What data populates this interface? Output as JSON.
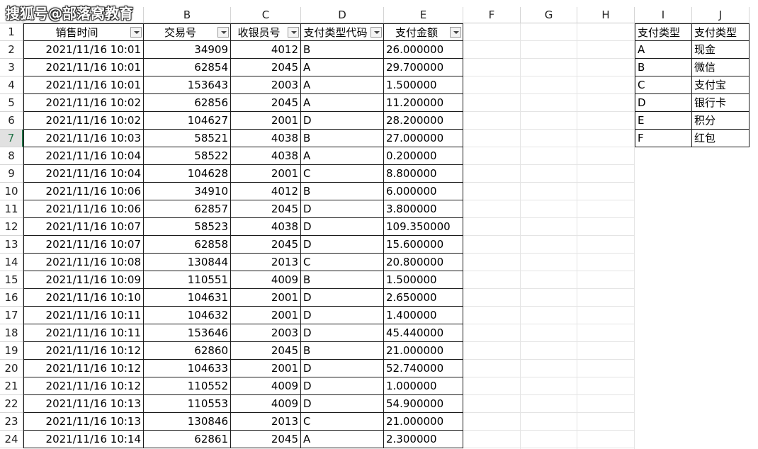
{
  "watermark": "搜狐号@部落窝教育",
  "columns": [
    "A",
    "B",
    "C",
    "D",
    "E",
    "F",
    "G",
    "H",
    "I",
    "J"
  ],
  "selected_row": 7,
  "headers": {
    "sale_time": "销售时间",
    "transaction_no": "交易号",
    "cashier_no": "收银员号",
    "pay_type_code": "支付类型代码",
    "pay_amount": "支付金额"
  },
  "rows": [
    {
      "time": "2021/11/16 10:01",
      "txn": "34909",
      "cashier": "4012",
      "type": "B",
      "amount": "26.000000"
    },
    {
      "time": "2021/11/16 10:01",
      "txn": "62854",
      "cashier": "2045",
      "type": "A",
      "amount": "29.700000"
    },
    {
      "time": "2021/11/16 10:01",
      "txn": "153643",
      "cashier": "2003",
      "type": "A",
      "amount": "1.500000"
    },
    {
      "time": "2021/11/16 10:02",
      "txn": "62856",
      "cashier": "2045",
      "type": "A",
      "amount": "11.200000"
    },
    {
      "time": "2021/11/16 10:02",
      "txn": "104627",
      "cashier": "2001",
      "type": "D",
      "amount": "28.200000"
    },
    {
      "time": "2021/11/16 10:03",
      "txn": "58521",
      "cashier": "4038",
      "type": "B",
      "amount": "27.000000"
    },
    {
      "time": "2021/11/16 10:04",
      "txn": "58522",
      "cashier": "4038",
      "type": "A",
      "amount": "0.200000"
    },
    {
      "time": "2021/11/16 10:04",
      "txn": "104628",
      "cashier": "2001",
      "type": "C",
      "amount": "8.800000"
    },
    {
      "time": "2021/11/16 10:06",
      "txn": "34910",
      "cashier": "4012",
      "type": "B",
      "amount": "6.000000"
    },
    {
      "time": "2021/11/16 10:06",
      "txn": "62857",
      "cashier": "2045",
      "type": "D",
      "amount": "3.800000"
    },
    {
      "time": "2021/11/16 10:07",
      "txn": "58523",
      "cashier": "4038",
      "type": "D",
      "amount": "109.350000"
    },
    {
      "time": "2021/11/16 10:07",
      "txn": "62858",
      "cashier": "2045",
      "type": "D",
      "amount": "15.600000"
    },
    {
      "time": "2021/11/16 10:08",
      "txn": "130844",
      "cashier": "2013",
      "type": "C",
      "amount": "20.800000"
    },
    {
      "time": "2021/11/16 10:09",
      "txn": "110551",
      "cashier": "4009",
      "type": "B",
      "amount": "1.500000"
    },
    {
      "time": "2021/11/16 10:10",
      "txn": "104631",
      "cashier": "2001",
      "type": "D",
      "amount": "2.650000"
    },
    {
      "time": "2021/11/16 10:11",
      "txn": "104632",
      "cashier": "2001",
      "type": "D",
      "amount": "1.400000"
    },
    {
      "time": "2021/11/16 10:11",
      "txn": "153646",
      "cashier": "2003",
      "type": "D",
      "amount": "45.440000"
    },
    {
      "time": "2021/11/16 10:12",
      "txn": "62860",
      "cashier": "2045",
      "type": "B",
      "amount": "21.000000"
    },
    {
      "time": "2021/11/16 10:12",
      "txn": "104633",
      "cashier": "2001",
      "type": "D",
      "amount": "52.740000"
    },
    {
      "time": "2021/11/16 10:12",
      "txn": "110552",
      "cashier": "4009",
      "type": "D",
      "amount": "1.000000"
    },
    {
      "time": "2021/11/16 10:13",
      "txn": "110553",
      "cashier": "4009",
      "type": "D",
      "amount": "54.900000"
    },
    {
      "time": "2021/11/16 10:13",
      "txn": "130846",
      "cashier": "2013",
      "type": "C",
      "amount": "21.000000"
    },
    {
      "time": "2021/11/16 10:14",
      "txn": "62861",
      "cashier": "2045",
      "type": "A",
      "amount": "2.300000"
    }
  ],
  "lookup": {
    "headers": [
      "支付类型",
      "支付类型"
    ],
    "rows": [
      [
        "A",
        "现金"
      ],
      [
        "B",
        "微信"
      ],
      [
        "C",
        "支付宝"
      ],
      [
        "D",
        "银行卡"
      ],
      [
        "E",
        "积分"
      ],
      [
        "F",
        "红包"
      ]
    ]
  }
}
